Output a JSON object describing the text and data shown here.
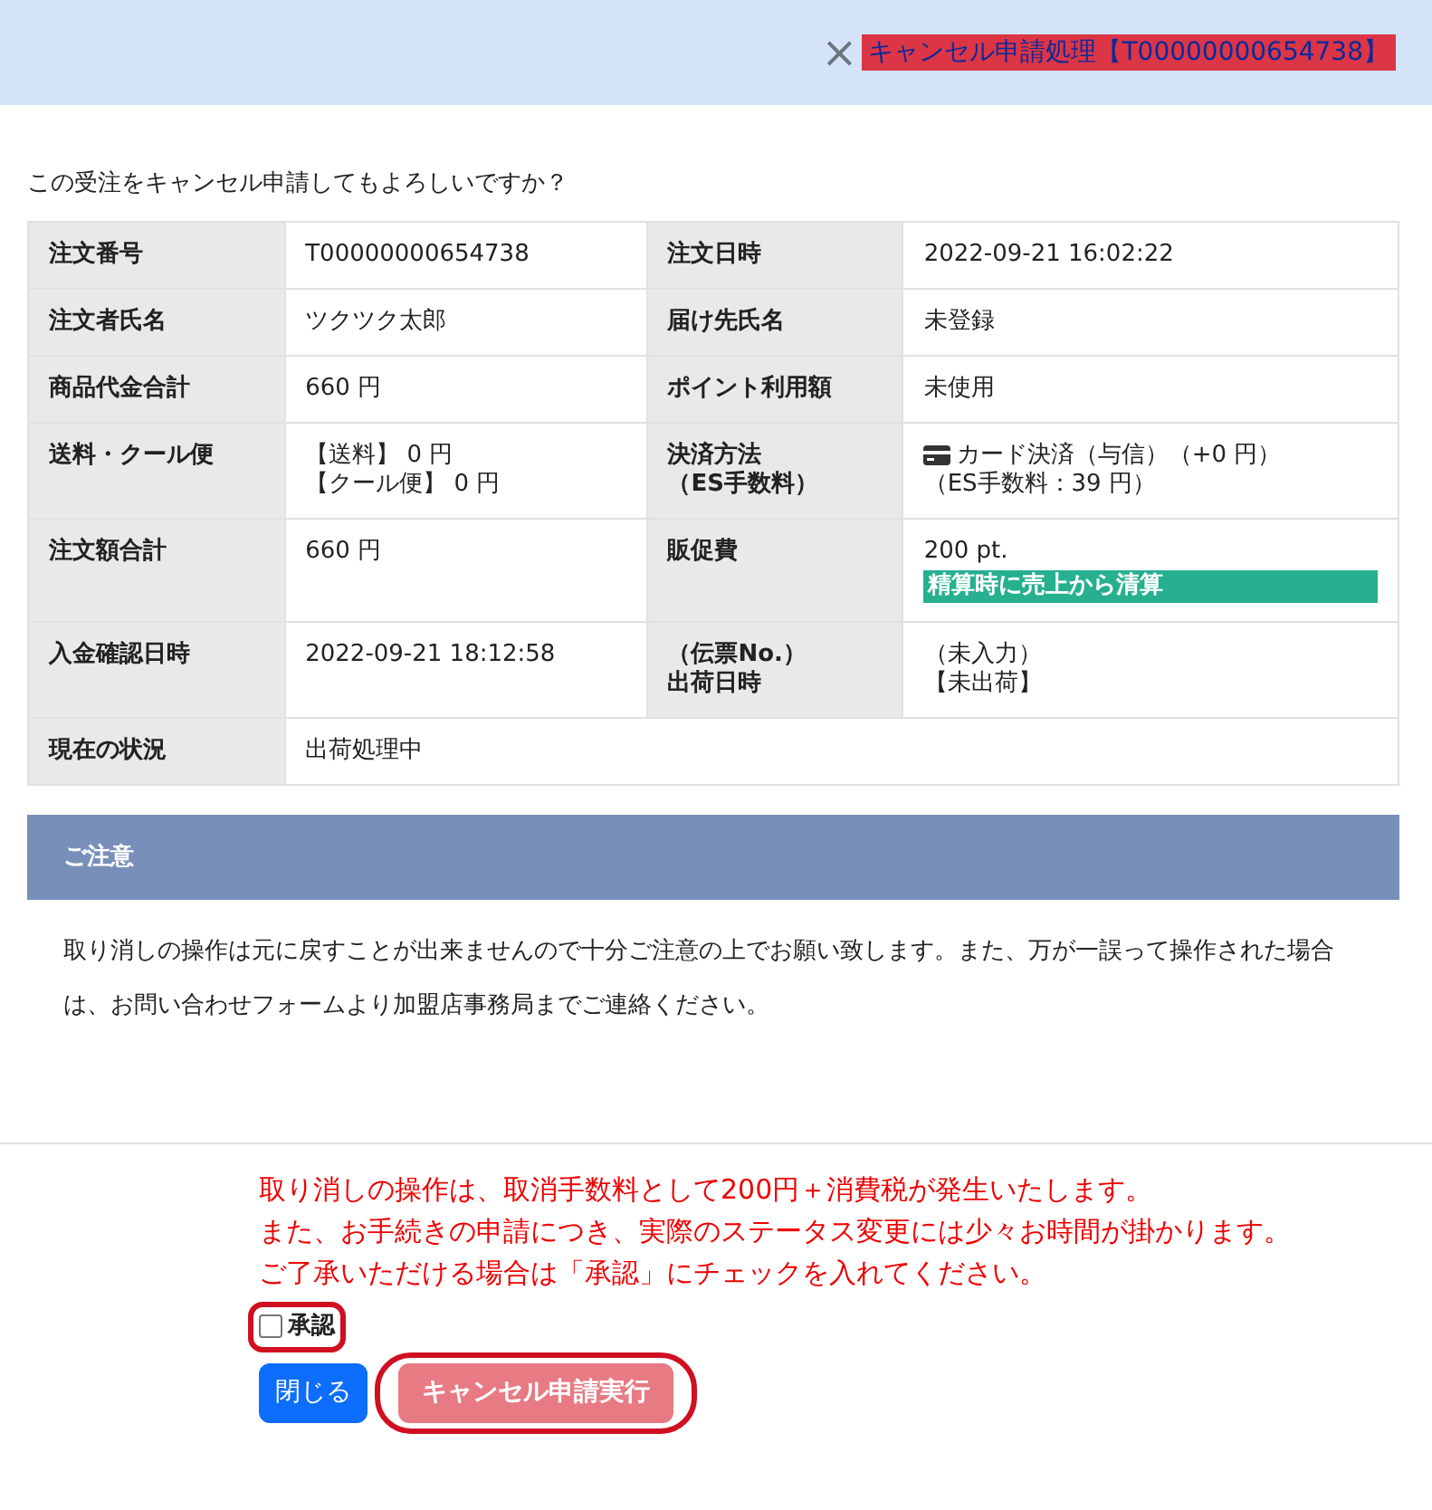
{
  "header": {
    "title": "キャンセル申請処理【T00000000654738】",
    "close": "×"
  },
  "question": "この受注をキャンセル申請してもよろしいですか？",
  "table": {
    "rows": [
      {
        "cells": [
          {
            "kind": "head",
            "lines": [
              {
                "kind": "text",
                "text": "注文番号"
              }
            ]
          },
          {
            "kind": "value",
            "lines": [
              {
                "kind": "text",
                "text": "T00000000654738"
              }
            ]
          },
          {
            "kind": "head",
            "lines": [
              {
                "kind": "text",
                "text": "注文日時"
              }
            ]
          },
          {
            "kind": "value",
            "lines": [
              {
                "kind": "text",
                "text": "2022-09-21 16:02:22"
              }
            ]
          }
        ]
      },
      {
        "cells": [
          {
            "kind": "head",
            "lines": [
              {
                "kind": "text",
                "text": "注文者氏名"
              }
            ]
          },
          {
            "kind": "value",
            "lines": [
              {
                "kind": "text",
                "text": "ツクツク太郎"
              }
            ]
          },
          {
            "kind": "head",
            "lines": [
              {
                "kind": "text",
                "text": "届け先氏名"
              }
            ]
          },
          {
            "kind": "value",
            "lines": [
              {
                "kind": "text",
                "text": "未登録"
              }
            ]
          }
        ]
      },
      {
        "cells": [
          {
            "kind": "head",
            "lines": [
              {
                "kind": "text",
                "text": "商品代金合計"
              }
            ]
          },
          {
            "kind": "value",
            "lines": [
              {
                "kind": "text",
                "text": "660 円"
              }
            ]
          },
          {
            "kind": "head",
            "lines": [
              {
                "kind": "text",
                "text": "ポイント利用額"
              }
            ]
          },
          {
            "kind": "value",
            "lines": [
              {
                "kind": "text",
                "text": "未使用"
              }
            ]
          }
        ]
      },
      {
        "cells": [
          {
            "kind": "head",
            "lines": [
              {
                "kind": "text",
                "text": "送料・クール便"
              }
            ]
          },
          {
            "kind": "value",
            "lines": [
              {
                "kind": "text",
                "text": "【送料】 0 円"
              },
              {
                "kind": "text",
                "text": "【クール便】 0 円"
              }
            ]
          },
          {
            "kind": "head",
            "lines": [
              {
                "kind": "text",
                "text": "決済方法"
              },
              {
                "kind": "text",
                "text": "（ES手数料）"
              }
            ]
          },
          {
            "kind": "value",
            "lines": [
              {
                "kind": "card",
                "text": "カード決済（与信）（+0 円）"
              },
              {
                "kind": "text",
                "text": "（ES手数料：39 円）"
              }
            ]
          }
        ]
      },
      {
        "cells": [
          {
            "kind": "head",
            "lines": [
              {
                "kind": "text",
                "text": "注文額合計"
              }
            ]
          },
          {
            "kind": "value",
            "lines": [
              {
                "kind": "text",
                "text": "660 円"
              }
            ]
          },
          {
            "kind": "head",
            "lines": [
              {
                "kind": "text",
                "text": "販促費"
              }
            ]
          },
          {
            "kind": "value",
            "lines": [
              {
                "kind": "text",
                "text": "200 pt."
              },
              {
                "kind": "tag",
                "text": "精算時に売上から清算"
              }
            ]
          }
        ]
      },
      {
        "cells": [
          {
            "kind": "head",
            "lines": [
              {
                "kind": "text",
                "text": "入金確認日時"
              }
            ]
          },
          {
            "kind": "value",
            "lines": [
              {
                "kind": "text",
                "text": "2022-09-21 18:12:58"
              }
            ]
          },
          {
            "kind": "head",
            "lines": [
              {
                "kind": "text",
                "text": "（伝票No.）"
              },
              {
                "kind": "text",
                "text": "出荷日時"
              }
            ]
          },
          {
            "kind": "value",
            "lines": [
              {
                "kind": "text",
                "text": "（未入力）"
              },
              {
                "kind": "text",
                "text": "【未出荷】"
              }
            ]
          }
        ]
      },
      {
        "cells": [
          {
            "kind": "head",
            "lines": [
              {
                "kind": "text",
                "text": "現在の状況"
              }
            ]
          },
          {
            "kind": "value",
            "colspan": 3,
            "lines": [
              {
                "kind": "text",
                "text": "出荷処理中"
              }
            ]
          }
        ]
      }
    ]
  },
  "notice": {
    "title": "ご注意",
    "text": "取り消しの操作は元に戻すことが出来ませんので十分ご注意の上でお願い致します。また、万が一誤って操作された場合は、お問い合わせフォームより加盟店事務局までご連絡ください。"
  },
  "warning": [
    "取り消しの操作は、取消手数料として200円＋消費税が発生いたします。",
    "また、お手続きの申請につき、実際のステータス変更には少々お時間が掛かります。",
    "ご了承いただける場合は「承認」にチェックを入れてください。"
  ],
  "approve": {
    "label": "承認",
    "checked": false
  },
  "buttons": [
    {
      "kind": "close",
      "label": "閉じる"
    },
    {
      "kind": "execute",
      "label": "キャンセル申請実行",
      "disabled": true
    }
  ]
}
